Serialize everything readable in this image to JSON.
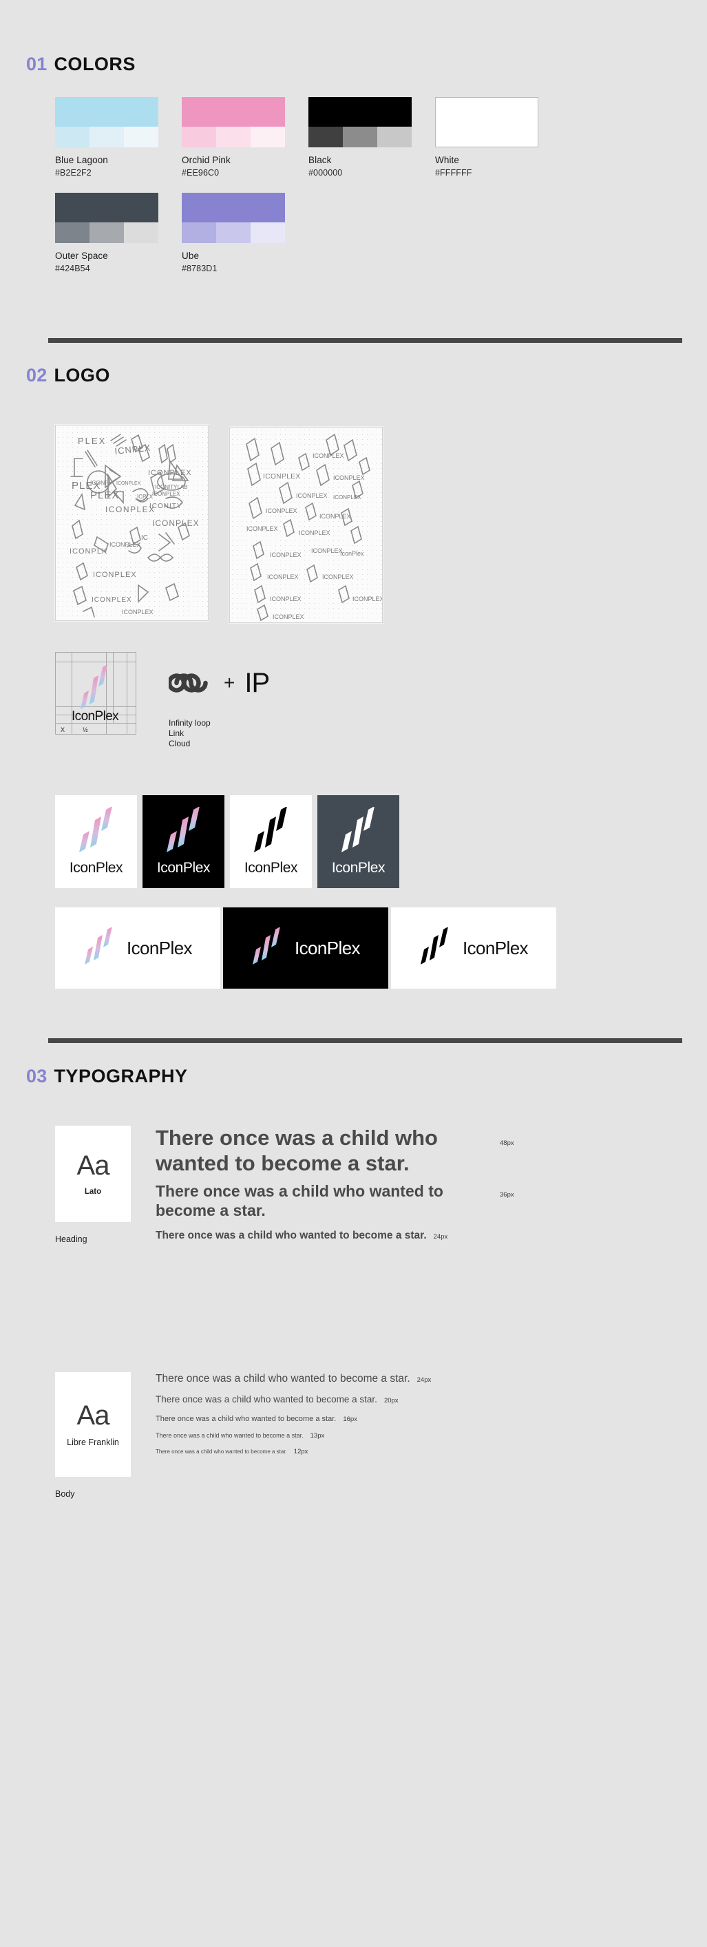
{
  "sections": {
    "colors": {
      "number": "01",
      "title": "COLORS"
    },
    "logo": {
      "number": "02",
      "title": "LOGO"
    },
    "typography": {
      "number": "03",
      "title": "TYPOGRAPHY"
    }
  },
  "colors": {
    "swatches": [
      {
        "name": "Blue Lagoon",
        "hex": "#B2E2F2",
        "main": "#ACDEF0",
        "tints": [
          "#CCE8F2",
          "#E1F0F7",
          "#EFF6FA"
        ],
        "plain": false
      },
      {
        "name": "Orchid Pink",
        "hex": "#EE96C0",
        "main": "#EE96C0",
        "tints": [
          "#F8CBDF",
          "#FBDFEA",
          "#FDF0F4"
        ],
        "plain": false
      },
      {
        "name": "Black",
        "hex": "#000000",
        "main": "#000000",
        "tints": [
          "#404040",
          "#8C8C8C",
          "#C8C8C8"
        ],
        "plain": false
      },
      {
        "name": "White",
        "hex": "#FFFFFF",
        "main": "#FFFFFF",
        "tints": [],
        "plain": true
      },
      {
        "name": "Outer Space",
        "hex": "#424B54",
        "main": "#424B54",
        "tints": [
          "#7E848C",
          "#A6AAAF",
          "#DCDCDC"
        ],
        "plain": false
      },
      {
        "name": "Ube",
        "hex": "#8783D1",
        "main": "#8783D1",
        "tints": [
          "#B2AFE2",
          "#C9C7EC",
          "#E8E7F7"
        ],
        "plain": false
      }
    ]
  },
  "logo": {
    "sketch_labels": [
      "logo-sketch-sheet-1",
      "logo-sketch-sheet-2"
    ],
    "sketch_words": [
      "PLEX",
      "ICONPLX",
      "ICONPLEX",
      "ICONITY",
      "ICONITYLAB",
      "ICONIPLEX",
      "ICNPLX",
      "IC",
      "PLX",
      "ICON"
    ],
    "construction": {
      "wordmark": "IconPlex",
      "measure_x": "X",
      "measure_half": "½"
    },
    "concept": {
      "plus": "+",
      "monogram": "IP",
      "keywords": [
        "Infinity loop",
        "Link",
        "Cloud"
      ]
    },
    "tiles": [
      {
        "variant": "light-gradient",
        "word": "IconPlex"
      },
      {
        "variant": "black-gradient",
        "word": "IconPlex"
      },
      {
        "variant": "light-mono",
        "word": "IconPlex"
      },
      {
        "variant": "dark-mono",
        "word": "IconPlex"
      }
    ],
    "bars": [
      {
        "variant": "light-gradient",
        "word": "IconPlex"
      },
      {
        "variant": "black-gradient",
        "word": "IconPlex"
      },
      {
        "variant": "light-mono",
        "word": "IconPlex"
      }
    ]
  },
  "typography": {
    "heading": {
      "label": "Heading",
      "glyph": "Aa",
      "font_name": "Lato",
      "samples": [
        {
          "text": "There once was a child who wanted to become a star.",
          "size": "48px"
        },
        {
          "text": "There once was a child who wanted to become a star.",
          "size": "36px"
        },
        {
          "text": "There once was a child who wanted to become a star.",
          "size": "24px"
        }
      ]
    },
    "body": {
      "label": "Body",
      "glyph": "Aa",
      "font_name": "Libre Franklin",
      "samples": [
        {
          "text": "There once was a child who wanted to become a star.",
          "size": "24px"
        },
        {
          "text": "There once was a child who wanted to become a star.",
          "size": "20px"
        },
        {
          "text": "There once was a child who wanted to become a star.",
          "size": "16px"
        },
        {
          "text": "There once was a child who wanted to become a star.",
          "size": "13px"
        },
        {
          "text": "There once was a child who wanted to become a star.",
          "size": "12px"
        }
      ]
    }
  },
  "palette": {
    "background": "#E4E4E4",
    "accent": "#8783D1",
    "rule": "#474747",
    "ink": "#111111",
    "gradient_pink": "#EE96C0",
    "gradient_blue": "#ACDEF0"
  }
}
